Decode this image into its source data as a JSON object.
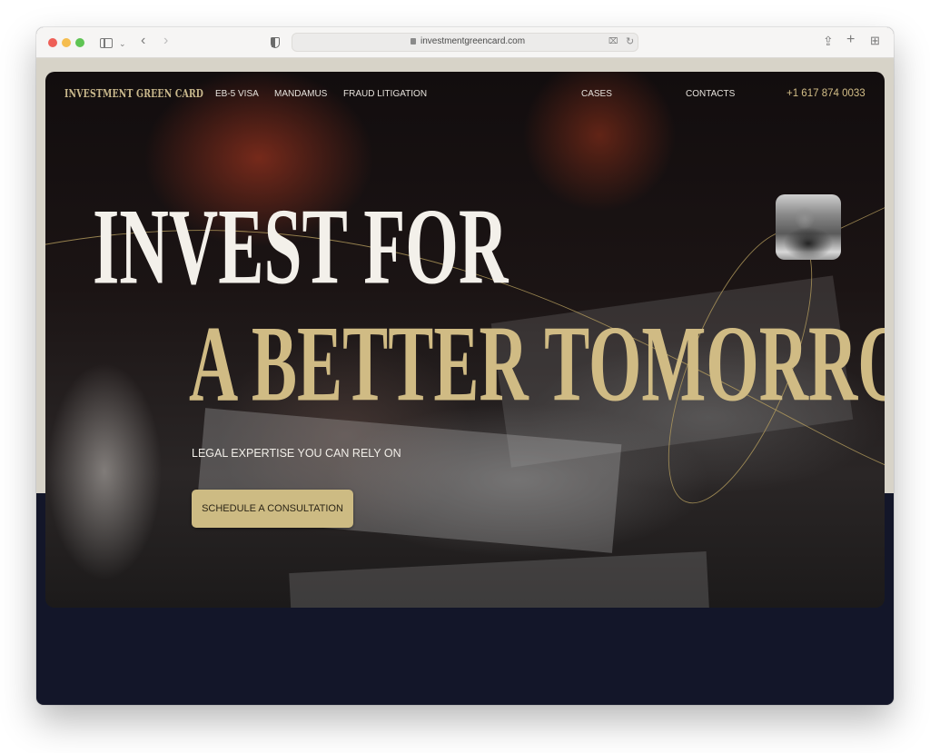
{
  "browser": {
    "url": "investmentgreencard.com",
    "icons": {
      "back": "‹",
      "forward": "›",
      "chevron": "⌄",
      "reload": "↻",
      "translate": "⌧",
      "share": "⇪",
      "new_tab": "+",
      "tab_overview": "⊞"
    }
  },
  "site": {
    "logo": "INVESTMENT GREEN CARD",
    "nav": [
      {
        "label": "EB-5 VISA"
      },
      {
        "label": "MANDAMUS"
      },
      {
        "label": "FRAUD LITIGATION"
      },
      {
        "label": "CASES"
      },
      {
        "label": "CONTACTS"
      }
    ],
    "phone": "+1 617 874 0033",
    "colors": {
      "gold": "#cdbb83",
      "navy": "#131629",
      "beige": "#d7d3c8"
    }
  },
  "hero": {
    "headline_line1": "INVEST FOR",
    "headline_line2": "A BETTER TOMORROW",
    "tagline": "LEGAL EXPERTISE YOU CAN RELY ON",
    "cta_label": "SCHEDULE A CONSULTATION"
  }
}
